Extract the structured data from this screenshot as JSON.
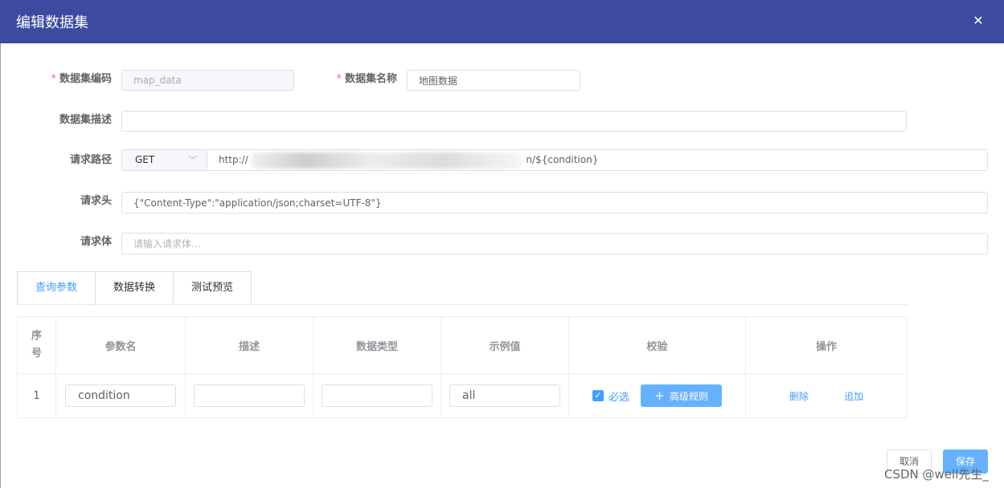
{
  "dialog": {
    "title": "编辑数据集",
    "close_glyph": "✕"
  },
  "form": {
    "code": {
      "label": "数据集编码",
      "value": "map_data"
    },
    "name": {
      "label": "数据集名称",
      "value": "地图数据"
    },
    "desc": {
      "label": "数据集描述",
      "value": ""
    },
    "path": {
      "label": "请求路径",
      "method": "GET",
      "url_start": "http://",
      "url_end": "n/${condition}"
    },
    "headers": {
      "label": "请求头",
      "value": "{\"Content-Type\":\"application/json;charset=UTF-8\"}"
    },
    "body": {
      "label": "请求体",
      "placeholder": "请输入请求体..."
    }
  },
  "tabs": [
    {
      "label": "查询参数",
      "active": true
    },
    {
      "label": "数据转换",
      "active": false
    },
    {
      "label": "测试预览",
      "active": false
    }
  ],
  "table": {
    "columns": [
      "序号",
      "参数名",
      "描述",
      "数据类型",
      "示例值",
      "校验",
      "操作"
    ],
    "rows": [
      {
        "index": "1",
        "param_name": "condition",
        "description": "",
        "data_type": "",
        "example": "all",
        "required_label": "必选",
        "rule_button": "高级规则",
        "delete": "删除",
        "add": "追加"
      }
    ]
  },
  "footer": {
    "cancel": "取消",
    "save": "保存"
  },
  "watermark": "CSDN @well先生_",
  "colors": {
    "header_bg": "#3c4aa0",
    "primary": "#409eff",
    "required": "#f56c6c"
  }
}
